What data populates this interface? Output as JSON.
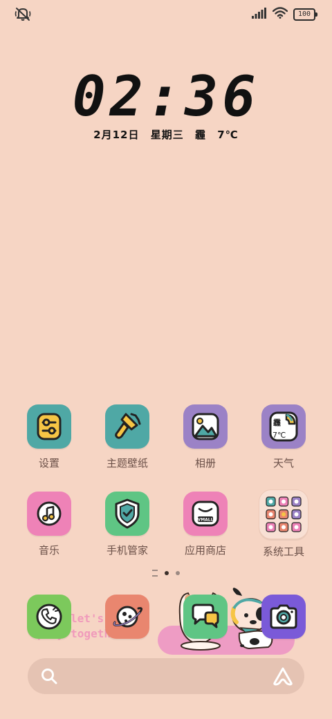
{
  "status_bar": {
    "left_icon": "bell-muted-icon",
    "signal_icon": "signal-bars-icon",
    "wifi_icon": "wifi-icon",
    "battery_level": "100"
  },
  "clock": {
    "time": "02:36",
    "date": "2月12日",
    "weekday": "星期三",
    "weather": "霾",
    "temperature": "7℃"
  },
  "apps": [
    {
      "label": "设置",
      "icon": "settings-sliders-icon",
      "color": "#4fa8a5"
    },
    {
      "label": "主题壁纸",
      "icon": "paintbrush-icon",
      "color": "#4fa8a5"
    },
    {
      "label": "相册",
      "icon": "gallery-icon",
      "color": "#9b82c6"
    },
    {
      "label": "天气",
      "icon": "weather-icon",
      "color": "#9b82c6",
      "inner_weather": "霾",
      "inner_temp": "7℃"
    },
    {
      "label": "音乐",
      "icon": "music-icon",
      "color": "#ee82b7"
    },
    {
      "label": "手机管家",
      "icon": "shield-icon",
      "color": "#5fc584"
    },
    {
      "label": "应用商店",
      "icon": "app-store-icon",
      "color": "#ee82b7",
      "inner_text": "VMALL"
    },
    {
      "label": "系统工具",
      "icon": "folder-icon",
      "color": "#f8e0d4"
    }
  ],
  "page_indicator": {
    "current": 1,
    "total": 2
  },
  "dock": {
    "decor_text_line1": "let's",
    "decor_text_line2": "play together",
    "apps": [
      {
        "name": "phone",
        "icon": "phone-icon",
        "color": "#7cc95c"
      },
      {
        "name": "browser",
        "icon": "planet-icon",
        "color": "#e9866f"
      },
      {
        "name": "messages",
        "icon": "chat-bubble-icon",
        "color": "#5fc584"
      },
      {
        "name": "camera",
        "icon": "camera-icon",
        "color": "#7a5ad8"
      }
    ]
  },
  "search": {
    "search_icon": "search-icon",
    "assistant_icon": "assistant-icon"
  }
}
